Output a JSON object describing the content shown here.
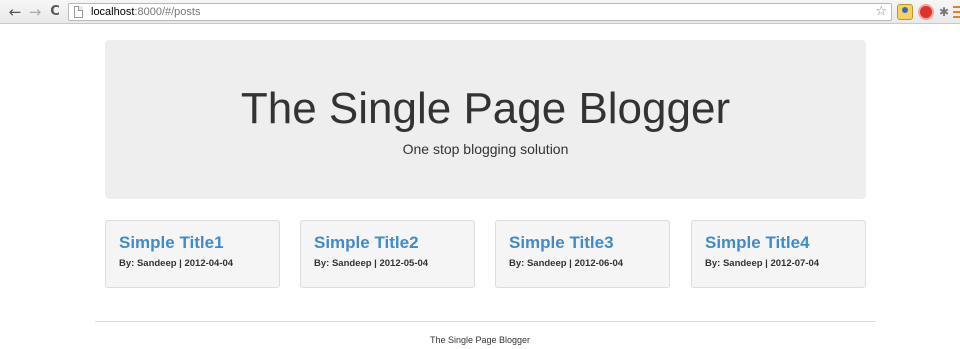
{
  "browser": {
    "back_glyph": "←",
    "forward_glyph": "→",
    "reload_glyph": "C",
    "url_host": "localhost",
    "url_path": ":8000/#/posts",
    "star_glyph": "☆",
    "extensions": [
      "extension-icon-1",
      "extension-icon-2",
      "extension-icon-3"
    ],
    "menu_color": "#e67e22"
  },
  "jumbotron": {
    "title": "The Single Page Blogger",
    "subtitle": "One stop blogging solution"
  },
  "posts": [
    {
      "title": "Simple Title1",
      "meta": "By: Sandeep | 2012-04-04"
    },
    {
      "title": "Simple Title2",
      "meta": "By: Sandeep | 2012-05-04"
    },
    {
      "title": "Simple Title3",
      "meta": "By: Sandeep | 2012-06-04"
    },
    {
      "title": "Simple Title4",
      "meta": "By: Sandeep | 2012-07-04"
    }
  ],
  "footer": {
    "text": "The Single Page Blogger"
  },
  "colors": {
    "link": "#428bca",
    "jumbotron_bg": "#eeeeee",
    "card_bg": "#f5f5f5"
  }
}
